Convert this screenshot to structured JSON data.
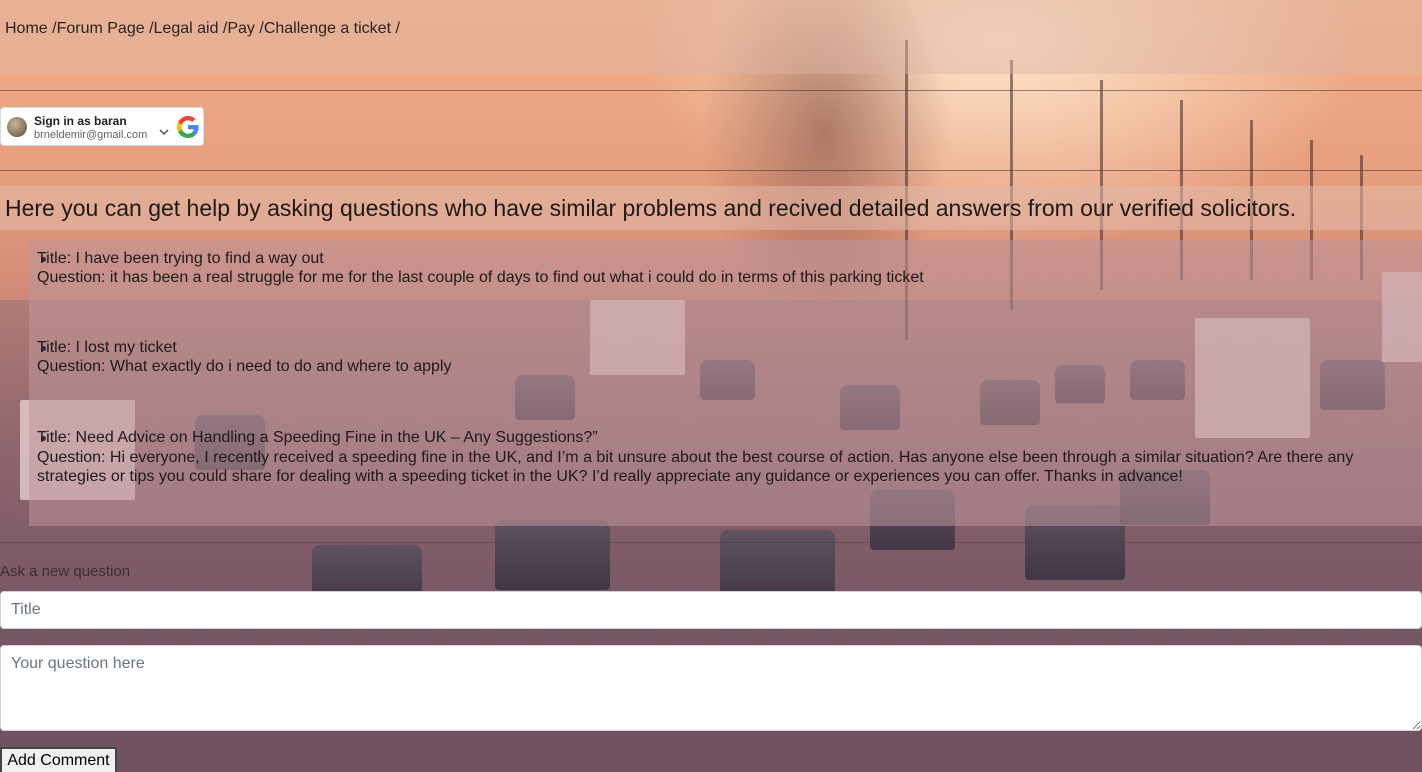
{
  "breadcrumb": [
    {
      "label": "Home /"
    },
    {
      "label": "Forum Page /"
    },
    {
      "label": "Legal aid /"
    },
    {
      "label": "Pay /"
    },
    {
      "label": "Challenge a ticket /"
    }
  ],
  "google_signin": {
    "name_line": "Sign in as baran",
    "email": "brneldemir@gmail.com",
    "chevron_icon": "chevron-down-icon",
    "logo_icon": "google-logo-icon"
  },
  "heading": "Here you can get help by asking questions who have similar problems and recived detailed answers from our verified solicitors.",
  "questions": [
    {
      "title_line": "Title: I have been trying to find a way out",
      "question_line": "Question: it has been a real struggle for me for the last couple of days to find out what i could do in terms of this parking ticket"
    },
    {
      "title_line": "Title: I lost my ticket",
      "question_line": "Question: What exactly do i need to do and where to apply"
    },
    {
      "title_line": "Title: Need Advice on Handling a Speeding Fine in the UK – Any Suggestions?”",
      "question_line": "Question: Hi everyone, I recently received a speeding fine in the UK, and I’m a bit unsure about the best course of action. Has anyone else been through a similar situation? Are there any strategies or tips you could share for dealing with a speeding ticket in the UK? I’d really appreciate any guidance or experiences you can offer. Thanks in advance!"
    }
  ],
  "form": {
    "section_label": "Ask a new question",
    "title_placeholder": "Title",
    "question_placeholder": "Your question here",
    "submit_label": "Add Comment"
  }
}
